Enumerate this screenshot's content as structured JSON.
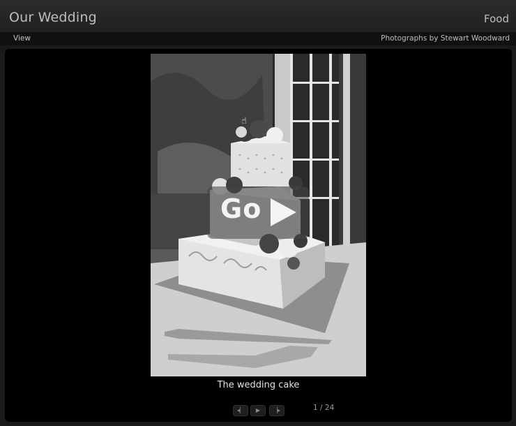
{
  "header": {
    "title": "Our Wedding",
    "gallery_name": "Food"
  },
  "subbar": {
    "view_menu": "View",
    "credit": "Photographs by Stewart Woodward"
  },
  "viewer": {
    "go_label": "Go",
    "caption": "The wedding cake",
    "counter": "1 / 24",
    "controls": [
      {
        "name": "previous-icon",
        "glyph": "◂▏"
      },
      {
        "name": "play-icon",
        "glyph": "▶"
      },
      {
        "name": "next-icon",
        "glyph": "▕▸"
      }
    ]
  },
  "colors": {
    "background": "#1a1a1a",
    "stage": "#000000",
    "text": "#bdbdbd"
  }
}
